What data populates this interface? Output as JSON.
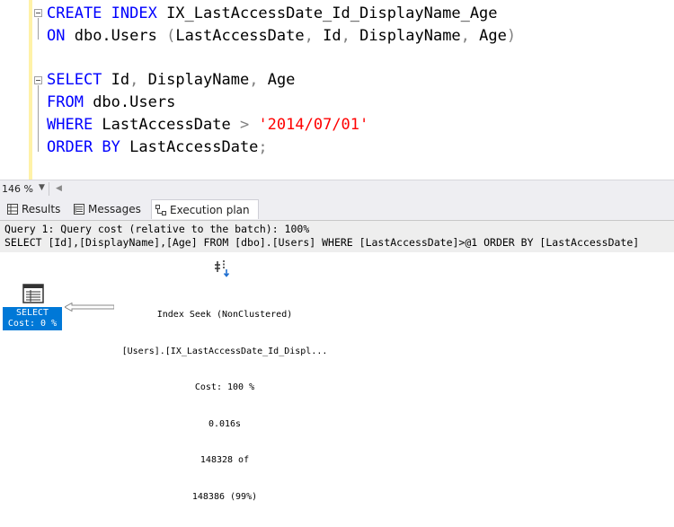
{
  "editor": {
    "lines": [
      {
        "kw": "CREATE INDEX",
        "rest": " IX_LastAccessDate_Id_DisplayName_Age"
      },
      {
        "kw": "ON",
        "rest": " dbo.Users ",
        "p1": "(",
        "cols": "LastAccessDate",
        "c1": ",",
        "cols2": " Id",
        "c2": ",",
        "cols3": " DisplayName",
        "c3": ",",
        "cols4": " Age",
        "p2": ")"
      },
      {
        "kw": "SELECT",
        "rest": " Id",
        "c1": ",",
        "r2": " DisplayName",
        "c2": ",",
        "r3": " Age"
      },
      {
        "kw": "FROM",
        "rest": " dbo.Users"
      },
      {
        "kw": "WHERE",
        "rest": " LastAccessDate ",
        "op": ">",
        "str": " '2014/07/01'"
      },
      {
        "kw": "ORDER BY",
        "rest": " LastAccessDate",
        "semi": ";"
      }
    ]
  },
  "zoom": {
    "level": "146 %"
  },
  "tabs": [
    {
      "label": "Results",
      "icon": "grid-icon"
    },
    {
      "label": "Messages",
      "icon": "messages-icon"
    },
    {
      "label": "Execution plan",
      "icon": "execution-plan-icon"
    }
  ],
  "plan": {
    "query_line": "Query 1: Query cost (relative to the batch): 100%",
    "sql_line": "SELECT [Id],[DisplayName],[Age] FROM [dbo].[Users] WHERE [LastAccessDate]>@1 ORDER BY [LastAccessDate]",
    "select_node": {
      "name": "SELECT",
      "cost": "Cost: 0 %"
    },
    "seek_node": {
      "name": "Index Seek (NonClustered)",
      "object": "[Users].[IX_LastAccessDate_Id_Displ...",
      "cost": "Cost: 100 %",
      "time": "0.016s",
      "rows_actual": "148328 of",
      "rows_estimated": "148386 (99%)"
    }
  },
  "colors": {
    "keyword": "#0000ff",
    "string": "#ff0000",
    "operator": "#808080",
    "accent": "#0078d7"
  }
}
